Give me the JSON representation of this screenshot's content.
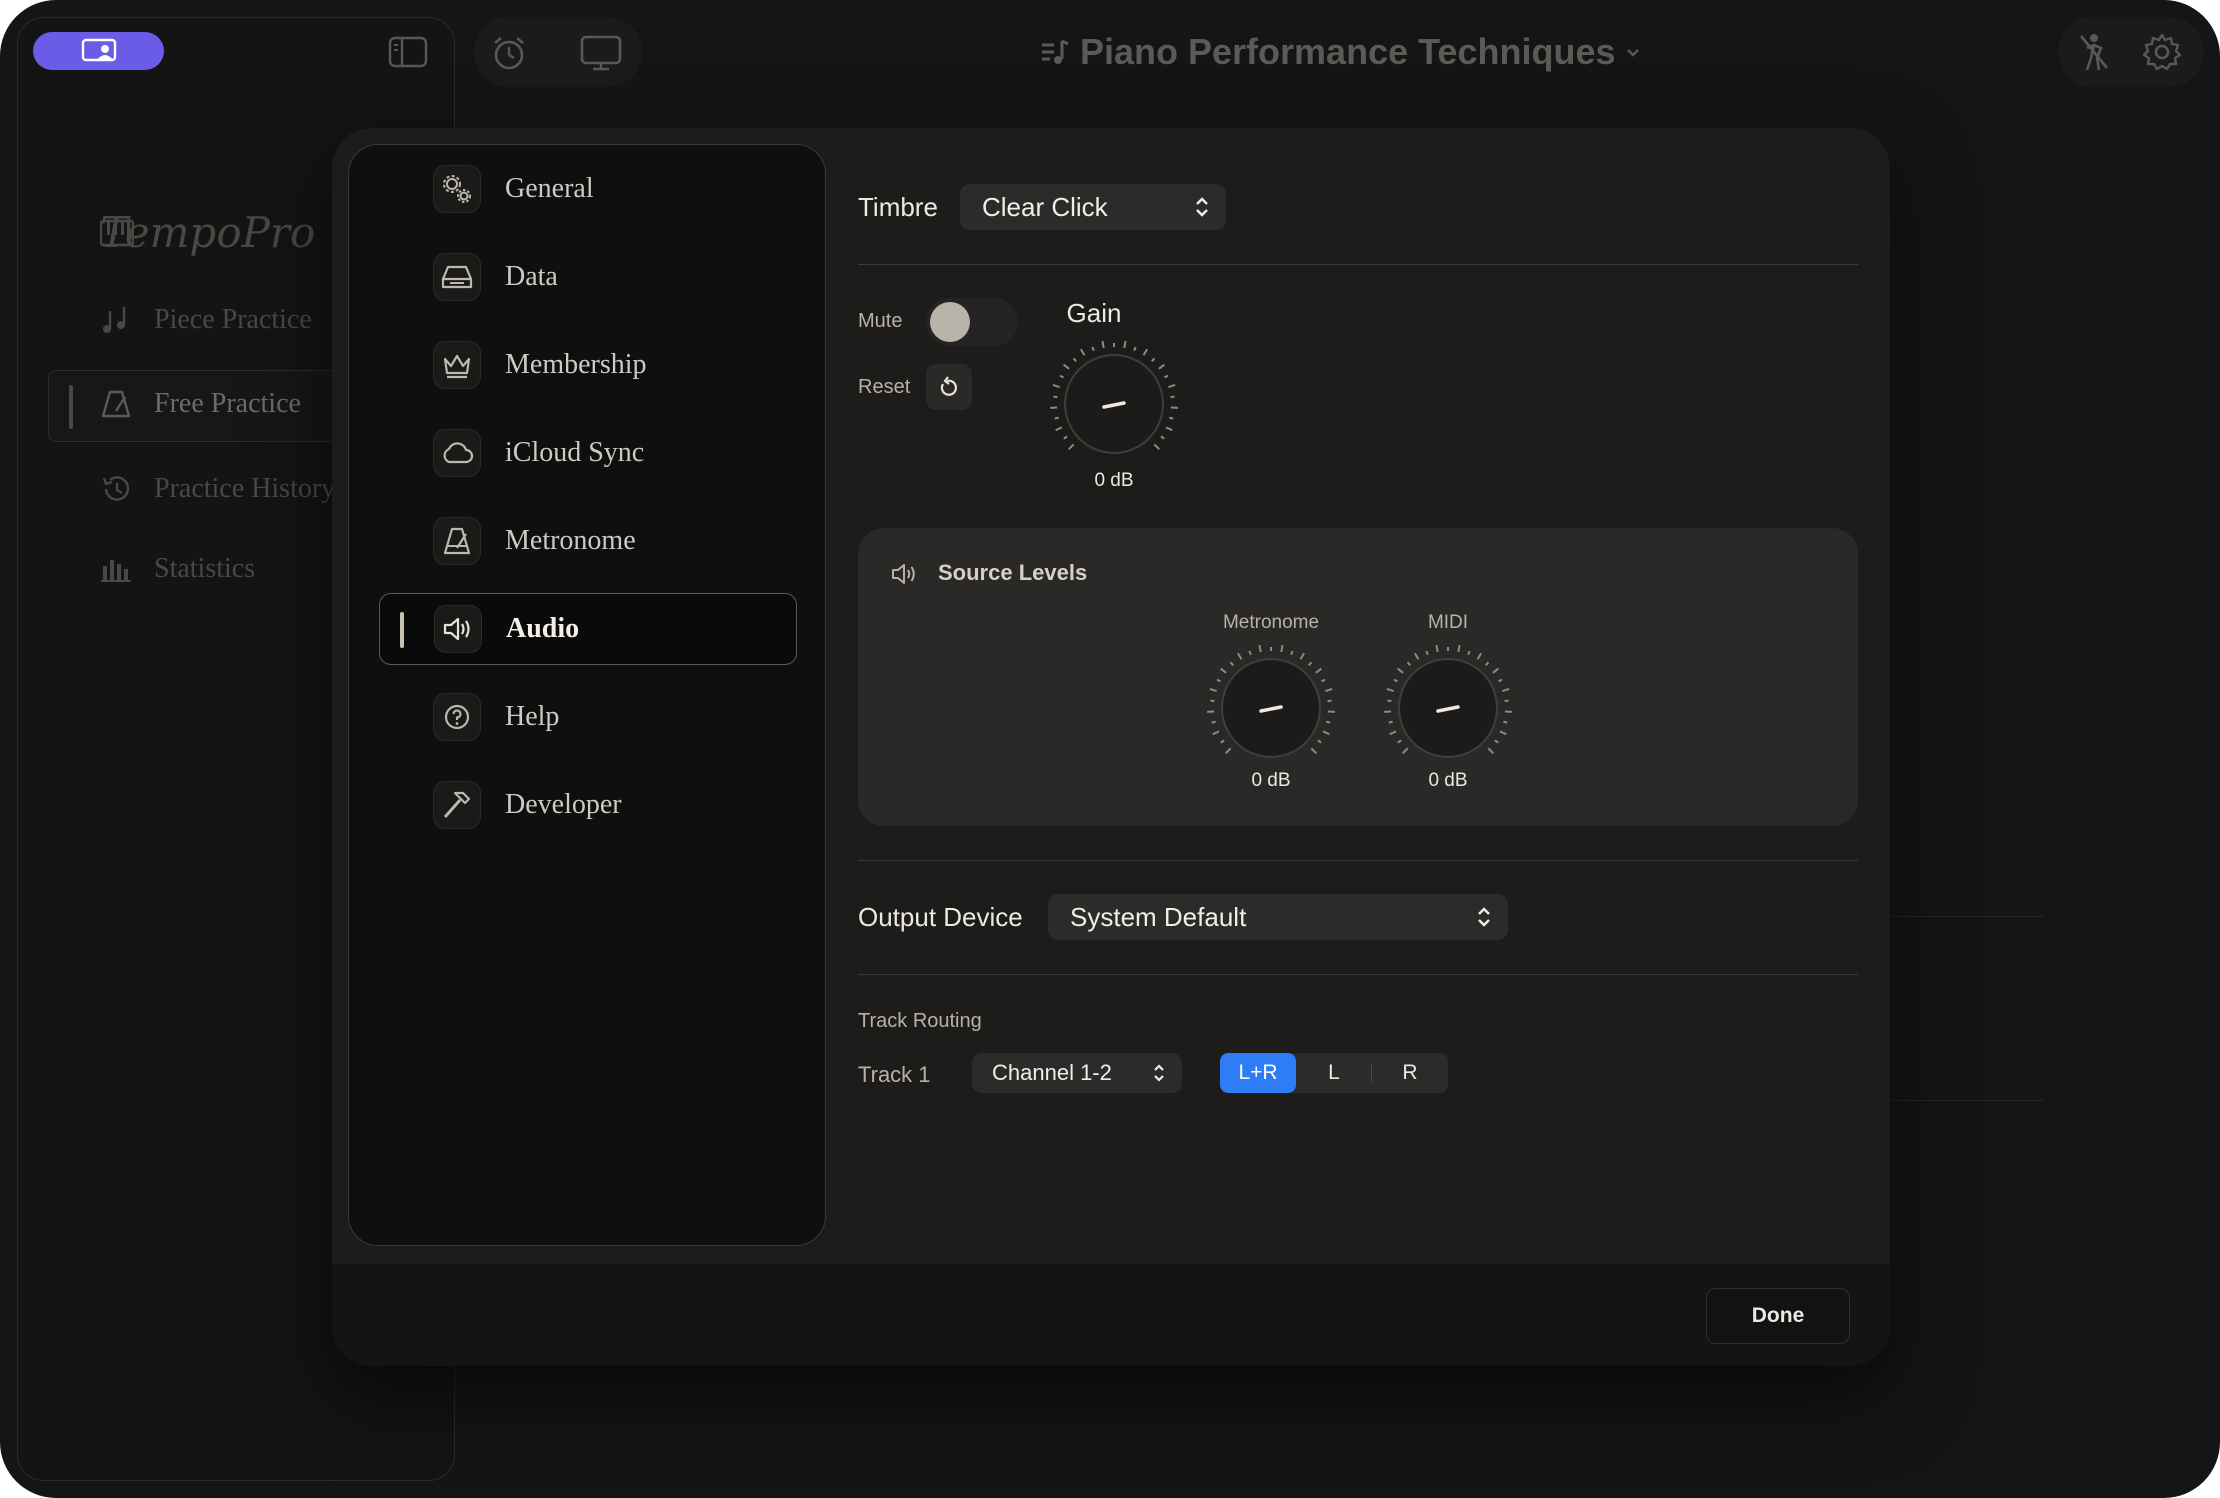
{
  "app": {
    "document_title": "Piano Performance Techniques",
    "brand": "TempoPro",
    "sidebar": [
      {
        "label": "Piece Practice",
        "icon": "music-notes-icon"
      },
      {
        "label": "Free Practice",
        "icon": "metronome-icon",
        "active": true
      },
      {
        "label": "Practice History",
        "icon": "history-icon"
      },
      {
        "label": "Statistics",
        "icon": "bar-chart-icon"
      }
    ]
  },
  "settings": {
    "nav": [
      {
        "label": "General",
        "icon": "gears-icon"
      },
      {
        "label": "Data",
        "icon": "drive-icon"
      },
      {
        "label": "Membership",
        "icon": "crown-icon"
      },
      {
        "label": "iCloud Sync",
        "icon": "cloud-icon"
      },
      {
        "label": "Metronome",
        "icon": "metronome-icon"
      },
      {
        "label": "Audio",
        "icon": "speaker-icon",
        "active": true
      },
      {
        "label": "Help",
        "icon": "question-icon"
      },
      {
        "label": "Developer",
        "icon": "hammer-icon"
      }
    ],
    "audio": {
      "timbre_label": "Timbre",
      "timbre_value": "Clear Click",
      "mute_label": "Mute",
      "mute_on": false,
      "reset_label": "Reset",
      "gain_label": "Gain",
      "gain_value": "0 dB",
      "source_levels_title": "Source Levels",
      "metronome_label": "Metronome",
      "metronome_value": "0 dB",
      "midi_label": "MIDI",
      "midi_value": "0 dB",
      "output_device_label": "Output Device",
      "output_device_value": "System Default",
      "track_routing_label": "Track Routing",
      "track_label": "Track 1",
      "channel_value": "Channel 1-2",
      "pan_options": [
        "L+R",
        "L",
        "R"
      ],
      "pan_selected": "L+R"
    },
    "done_label": "Done"
  },
  "colors": {
    "accent": "#2e7cf6",
    "brand_pill": "#6a5ce6"
  }
}
